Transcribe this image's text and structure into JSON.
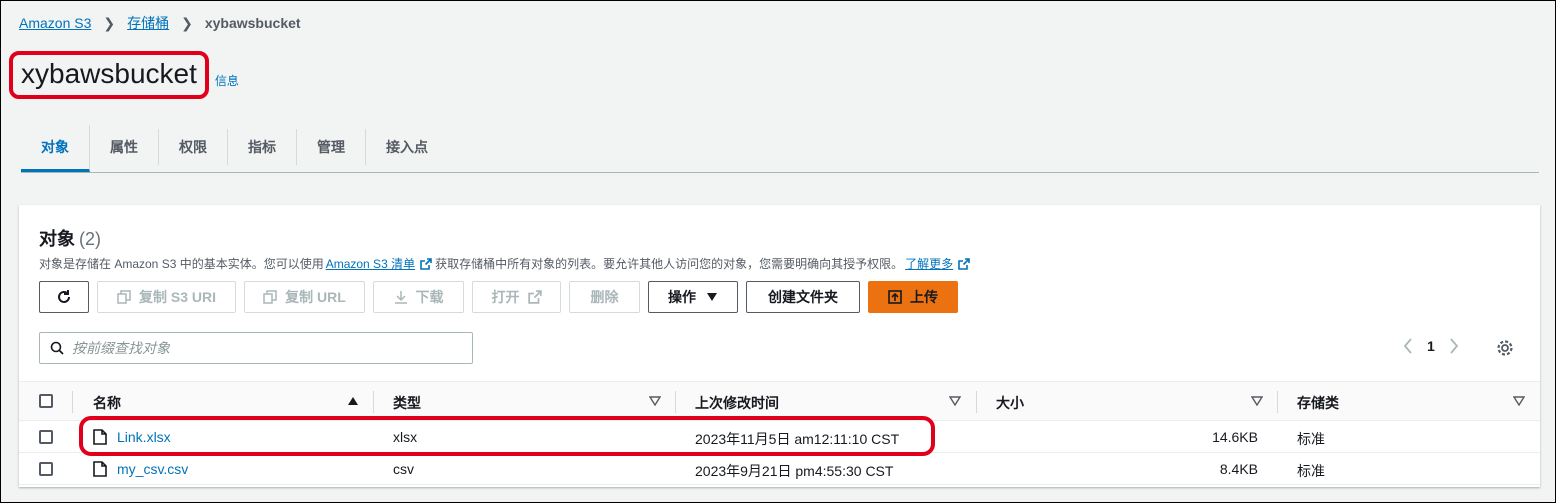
{
  "breadcrumb": {
    "items": [
      "Amazon S3",
      "存储桶"
    ],
    "current": "xybawsbucket"
  },
  "bucket": {
    "title": "xybawsbucket",
    "info_label": "信息"
  },
  "tabs": [
    {
      "label": "对象",
      "active": true
    },
    {
      "label": "属性",
      "active": false
    },
    {
      "label": "权限",
      "active": false
    },
    {
      "label": "指标",
      "active": false
    },
    {
      "label": "管理",
      "active": false
    },
    {
      "label": "接入点",
      "active": false
    }
  ],
  "objects": {
    "title": "对象",
    "count": "(2)",
    "desc_part1": "对象是存储在 Amazon S3 中的基本实体。您可以使用",
    "desc_link1": "Amazon S3 清单",
    "desc_part2": "获取存储桶中所有对象的列表。要允许其他人访问您的对象，您需要明确向其授予权限。",
    "desc_link2": "了解更多"
  },
  "toolbar": {
    "copy_s3_uri": "复制 S3 URI",
    "copy_url": "复制 URL",
    "download": "下载",
    "open": "打开",
    "delete": "删除",
    "actions": "操作",
    "create_folder": "创建文件夹",
    "upload": "上传"
  },
  "search": {
    "placeholder": "按前缀查找对象"
  },
  "pager": {
    "page": "1"
  },
  "table": {
    "headers": {
      "name": "名称",
      "type": "类型",
      "modified": "上次修改时间",
      "size": "大小",
      "storage": "存储类"
    },
    "rows": [
      {
        "name": "Link.xlsx",
        "type": "xlsx",
        "modified": "2023年11月5日 am12:11:10 CST",
        "size": "14.6KB",
        "storage": "标准"
      },
      {
        "name": "my_csv.csv",
        "type": "csv",
        "modified": "2023年9月21日 pm4:55:30 CST",
        "size": "8.4KB",
        "storage": "标准"
      }
    ]
  },
  "colors": {
    "link": "#0073bb",
    "primary": "#ec7211",
    "highlight": "#e0001b"
  }
}
